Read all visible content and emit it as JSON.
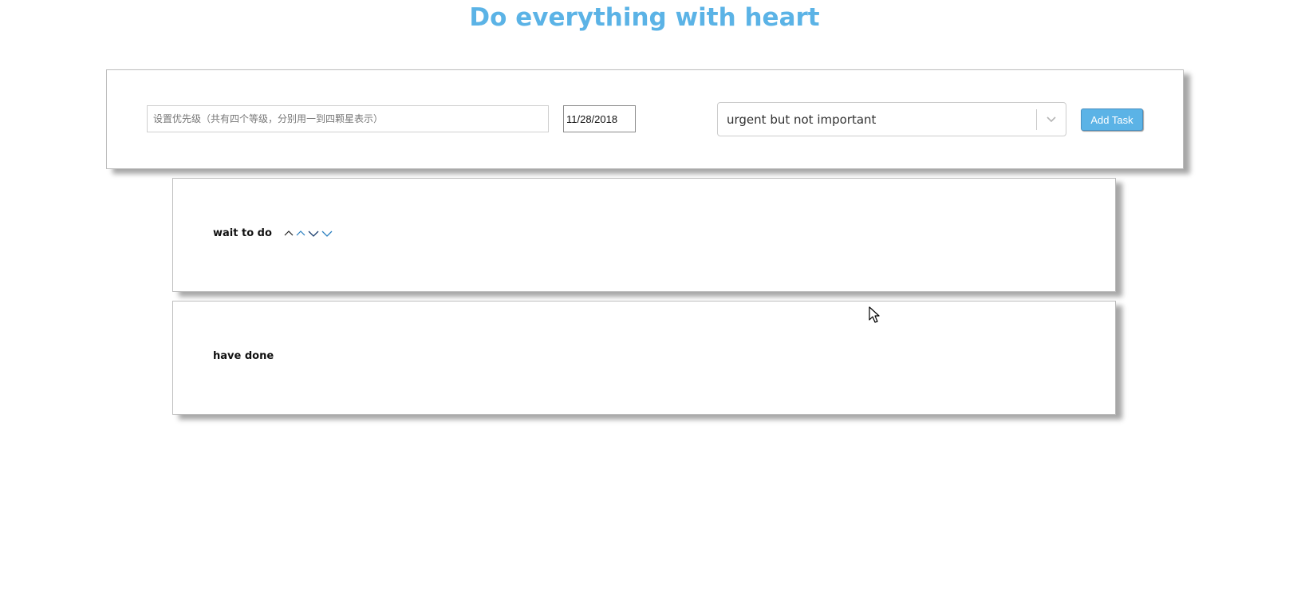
{
  "header": {
    "title": "Do everything with heart",
    "title_color": "#5bb3e6"
  },
  "task_form": {
    "task_input": {
      "value": "",
      "placeholder": "设置优先级（共有四个等级，分别用一到四颗星表示）"
    },
    "date_input": {
      "value": "11/28/2018"
    },
    "priority_select": {
      "selected": "urgent but not important",
      "icon": "chevron-down-icon"
    },
    "add_button_label": "Add Task",
    "accent_color": "#5bb3e6"
  },
  "lists": {
    "todo": {
      "heading": "wait to do",
      "icons": [
        "chevron-up-icon",
        "chevron-up-icon",
        "chevron-down-icon",
        "chevron-down-icon"
      ]
    },
    "done": {
      "heading": "have done"
    }
  }
}
